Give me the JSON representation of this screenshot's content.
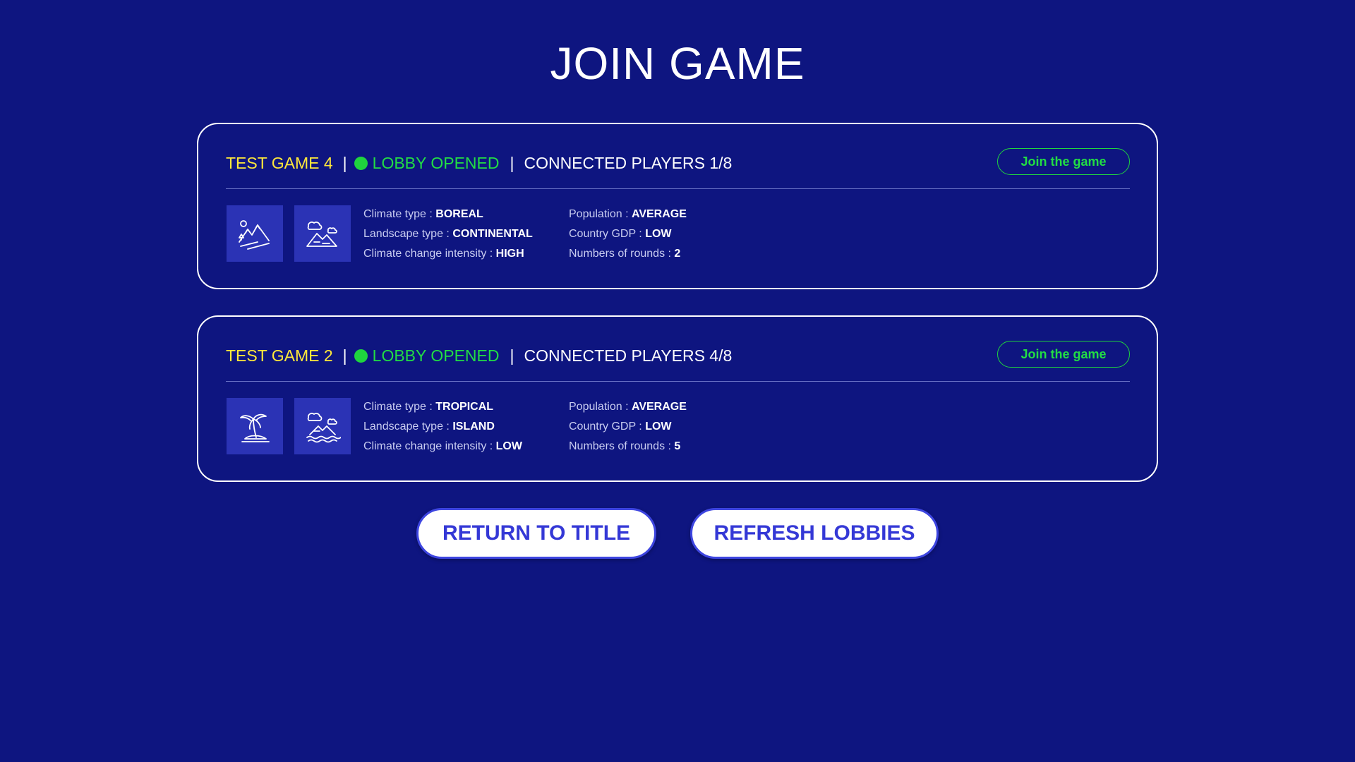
{
  "page": {
    "title": "JOIN GAME"
  },
  "lobbies": [
    {
      "name": "TEST GAME 4",
      "status": "LOBBY OPENED",
      "players": "CONNECTED PLAYERS 1/8",
      "join_label": "Join the game",
      "climate_label": "Climate type : ",
      "climate_value": "BOREAL",
      "landscape_label": "Landscape type : ",
      "landscape_value": "CONTINENTAL",
      "intensity_label": "Climate change intensity : ",
      "intensity_value": "HIGH",
      "population_label": "Population : ",
      "population_value": "AVERAGE",
      "gdp_label": "Country GDP : ",
      "gdp_value": "LOW",
      "rounds_label": "Numbers of rounds : ",
      "rounds_value": "2",
      "climate_icon": "boreal-icon",
      "landscape_icon": "continental-icon"
    },
    {
      "name": "TEST GAME 2",
      "status": "LOBBY OPENED",
      "players": "CONNECTED PLAYERS 4/8",
      "join_label": "Join the game",
      "climate_label": "Climate type : ",
      "climate_value": "TROPICAL",
      "landscape_label": "Landscape type : ",
      "landscape_value": "ISLAND",
      "intensity_label": "Climate change intensity : ",
      "intensity_value": "LOW",
      "population_label": "Population : ",
      "population_value": "AVERAGE",
      "gdp_label": "Country GDP : ",
      "gdp_value": "LOW",
      "rounds_label": "Numbers of rounds : ",
      "rounds_value": "5",
      "climate_icon": "tropical-icon",
      "landscape_icon": "island-icon"
    }
  ],
  "footer": {
    "return_label": "RETURN TO TITLE",
    "refresh_label": "REFRESH LOBBIES"
  },
  "colors": {
    "background": "#0e1580",
    "game_name": "#ffe83a",
    "status_open": "#22dd44",
    "icon_tile": "#2b33b5",
    "button_text": "#3438d6"
  }
}
